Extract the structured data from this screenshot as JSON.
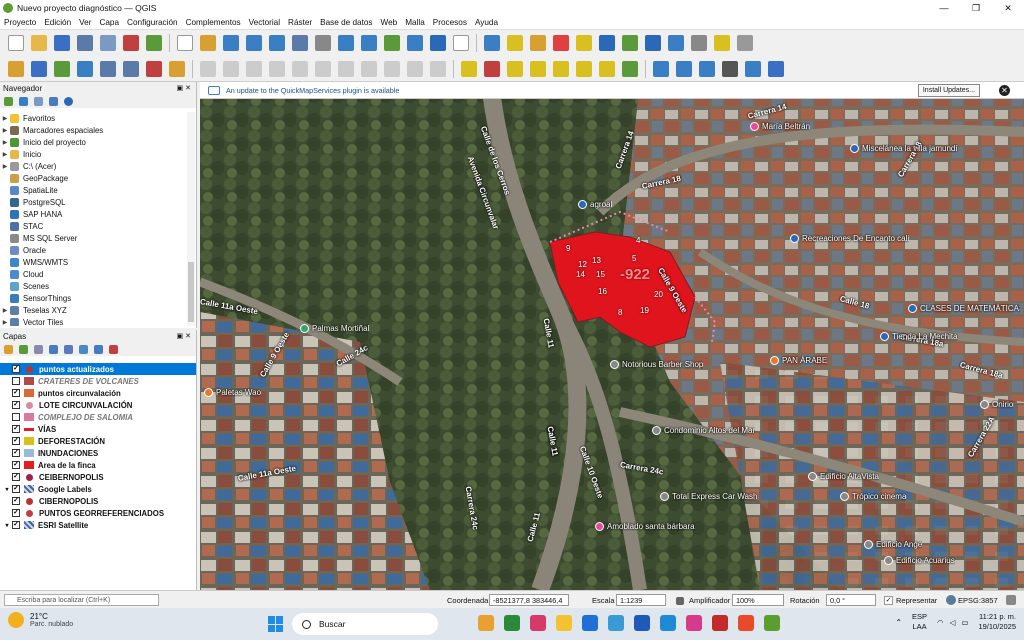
{
  "window": {
    "title": "Nuevo proyecto diagnóstico — QGIS"
  },
  "menu": [
    "Proyecto",
    "Edición",
    "Ver",
    "Capa",
    "Configuración",
    "Complementos",
    "Vectorial",
    "Ráster",
    "Base de datos",
    "Web",
    "Malla",
    "Procesos",
    "Ayuda"
  ],
  "navigator": {
    "title": "Navegador",
    "items": [
      {
        "label": "Favoritos",
        "icon": "star-icon",
        "color": "#f2c230",
        "expandable": true
      },
      {
        "label": "Marcadores espaciales",
        "icon": "bookmark-icon",
        "color": "#7a6a52",
        "expandable": true
      },
      {
        "label": "Inicio del proyecto",
        "icon": "project-home-icon",
        "color": "#4a9a33",
        "expandable": true
      },
      {
        "label": "Inicio",
        "icon": "folder-icon",
        "color": "#e6b84a",
        "expandable": true
      },
      {
        "label": "C:\\ (Acer)",
        "icon": "drive-icon",
        "color": "#9a9a9a",
        "expandable": true
      },
      {
        "label": "GeoPackage",
        "icon": "geopackage-icon",
        "color": "#c9a04a",
        "expandable": false
      },
      {
        "label": "SpatiaLite",
        "icon": "spatialite-icon",
        "color": "#5a88c4",
        "expandable": false
      },
      {
        "label": "PostgreSQL",
        "icon": "postgresql-icon",
        "color": "#336791",
        "expandable": false
      },
      {
        "label": "SAP HANA",
        "icon": "sap-hana-icon",
        "color": "#2d75b8",
        "expandable": false
      },
      {
        "label": "STAC",
        "icon": "stac-icon",
        "color": "#4f6fa8",
        "expandable": false
      },
      {
        "label": "MS SQL Server",
        "icon": "mssql-icon",
        "color": "#8a8a8a",
        "expandable": false
      },
      {
        "label": "Oracle",
        "icon": "oracle-icon",
        "color": "#6f8bc7",
        "expandable": false
      },
      {
        "label": "WMS/WMTS",
        "icon": "wms-icon",
        "color": "#3f86c9",
        "expandable": false
      },
      {
        "label": "Cloud",
        "icon": "cloud-icon",
        "color": "#4a8bd0",
        "expandable": false
      },
      {
        "label": "Scenes",
        "icon": "scenes-icon",
        "color": "#5aa3c9",
        "expandable": false
      },
      {
        "label": "SensorThings",
        "icon": "sensorthings-icon",
        "color": "#3a7abf",
        "expandable": false
      },
      {
        "label": "Teselas XYZ",
        "icon": "xyz-tiles-icon",
        "color": "#5b7fa8",
        "expandable": true
      },
      {
        "label": "Vector Tiles",
        "icon": "vector-tiles-icon",
        "color": "#5b7fa8",
        "expandable": true
      }
    ]
  },
  "layers": {
    "title": "Capas",
    "items": [
      {
        "label": "puntos actualizados",
        "checked": true,
        "selected": true,
        "style": "normal",
        "sym": "#c03030",
        "symshape": "dot",
        "expand": ""
      },
      {
        "label": "CRATERES DE VOLCANES",
        "checked": false,
        "selected": false,
        "style": "off",
        "sym": "#b04a4a",
        "symshape": "box",
        "expand": ""
      },
      {
        "label": "puntos circunvalación",
        "checked": true,
        "selected": false,
        "style": "normal",
        "sym": "#d86a3a",
        "symshape": "leaf",
        "expand": ""
      },
      {
        "label": "LOTE CIRCUNVALACIÓN",
        "checked": true,
        "selected": false,
        "style": "normal",
        "sym": "#d88aa0",
        "symshape": "dot",
        "expand": ""
      },
      {
        "label": "COMPLEJO DE SALOMIA",
        "checked": false,
        "selected": false,
        "style": "off",
        "sym": "#d87aa0",
        "symshape": "box",
        "expand": ""
      },
      {
        "label": "VÍAS",
        "checked": true,
        "selected": false,
        "style": "normal",
        "sym": "#e02020",
        "symshape": "line",
        "expand": ""
      },
      {
        "label": "DEFORESTACIÓN",
        "checked": true,
        "selected": false,
        "style": "normal",
        "sym": "#d8c020",
        "symshape": "box",
        "expand": ""
      },
      {
        "label": "INUNDACIONES",
        "checked": true,
        "selected": false,
        "style": "normal",
        "sym": "#9ab8d8",
        "symshape": "box",
        "expand": ""
      },
      {
        "label": "Area de la finca",
        "checked": true,
        "selected": false,
        "style": "normal",
        "sym": "#e02020",
        "symshape": "box",
        "expand": ""
      },
      {
        "label": "CEIBERNOPOLIS",
        "checked": true,
        "selected": false,
        "style": "normal",
        "sym": "#a02050",
        "symshape": "dot",
        "expand": ""
      },
      {
        "label": "Google Labels",
        "checked": true,
        "selected": false,
        "style": "normal",
        "sym": "#4060a0",
        "symshape": "grid",
        "expand": "▾"
      },
      {
        "label": "CIBERNOPOLIS",
        "checked": true,
        "selected": false,
        "style": "normal",
        "sym": "#c03030",
        "symshape": "dot",
        "expand": ""
      },
      {
        "label": "PUNTOS GEORREFERENCIADOS",
        "checked": true,
        "selected": false,
        "style": "normal",
        "sym": "#c04040",
        "symshape": "dot",
        "expand": ""
      },
      {
        "label": "ESRI Satellite",
        "checked": true,
        "selected": false,
        "style": "normal",
        "sym": "#4060a0",
        "symshape": "grid",
        "expand": "▾"
      }
    ]
  },
  "banner": {
    "message": "An update to the QuickMapServices plugin is available",
    "install_label": "Install Updates..."
  },
  "map": {
    "parcel_label": "-922",
    "point_numbers": [
      "4",
      "5",
      "9",
      "12",
      "13",
      "14",
      "15",
      "16",
      "20",
      "8",
      "19"
    ],
    "streets": [
      "Carrera 14",
      "Carrera 14",
      "Carrera 18",
      "Avenida Circunvalar",
      "Calle de los Cerros",
      "Calle 11a Oeste",
      "Calle 11",
      "Calle 9 Oeste",
      "Calle 24c",
      "Calle 11a Oeste",
      "Carrera 24c",
      "Calle 11",
      "Calle 10 Oeste",
      "Carrera 24c",
      "Calle 18",
      "Carrera 18a",
      "Carrera 18a",
      "Carrera 22A",
      "Carrera 18",
      "Calle 9 Oeste",
      "Calle 11",
      "Calle 11"
    ],
    "places": [
      "María Beltrán",
      "Miscelánea la villa jamundí",
      "agroal",
      "Recreaciones De Encanto cali",
      "CLASES DE MATEMÁTICAS",
      "Tienda La Mechita",
      "PAN ÁRABE",
      "Palmas Mortiñal",
      "Notorious Barber Shop",
      "Paletas Wao",
      "Condominio Altos del Mar",
      "Edificio AltaVista",
      "Total Express Car Wash",
      "Trópico cinema",
      "Amoblado santa bárbara",
      "Edificio Ange",
      "Edificio Acuarius",
      "Onirio"
    ]
  },
  "status": {
    "locator_placeholder": "Escriba para localizar (Ctrl+K)",
    "coord_label": "Coordenada",
    "coord_value": "-8521377,8 383446,4",
    "scale_label": "Escala",
    "scale_value": "1:1239",
    "magnifier_label": "Amplificador",
    "magnifier_value": "100%",
    "rotation_label": "Rotación",
    "rotation_value": "0,0 °",
    "render_label": "Representar",
    "crs": "EPSG:3857"
  },
  "taskbar": {
    "temp": "21°C",
    "weather": "Parc. nublado",
    "search": "Buscar",
    "lang1": "ESP",
    "lang2": "LAA",
    "time": "11:21 p. m.",
    "date": "19/10/2025"
  },
  "colors": {
    "accent": "#0078d7",
    "parcel": "#e0141c"
  }
}
